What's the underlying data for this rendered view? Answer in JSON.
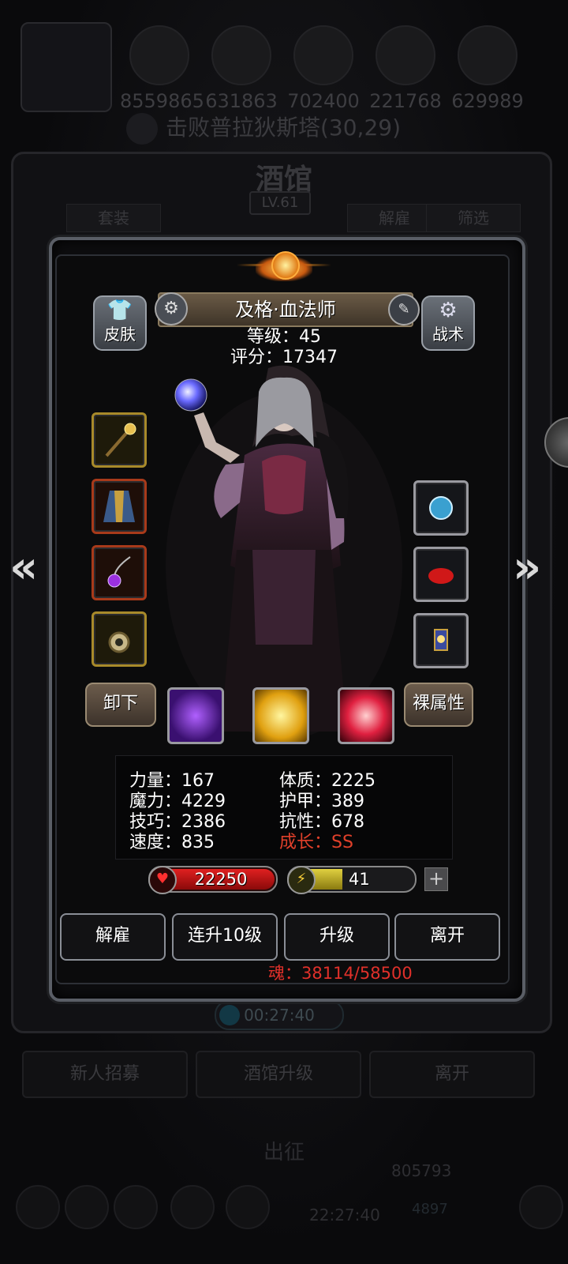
{
  "resources": [
    "8559865",
    "631863",
    "702400",
    "221768",
    "629989"
  ],
  "quest": "击败普拉狄斯塔(30,29)",
  "tavern": {
    "title": "酒馆",
    "level": "LV.61",
    "tab_left": "套装",
    "tab_dismiss": "解雇",
    "tab_filter": "筛选",
    "timer": "00:27:40",
    "btn_recruit": "新人招募",
    "btn_upgrade": "酒馆升级",
    "btn_leave": "离开",
    "sortie": "出征",
    "gold": "805793",
    "gems": "4897",
    "clock": "22:27:40"
  },
  "hero": {
    "name": "及格·血法师",
    "level_text": "等级：45",
    "score_text": "评分：17347",
    "skin_label": "皮肤",
    "tactics_label": "战术",
    "unequip_label": "卸下",
    "bare_attr_label": "裸属性",
    "left_slots": [
      "staff-icon",
      "robe-icon",
      "amulet-icon",
      "ring-icon"
    ],
    "right_slots": [
      "orb-icon",
      "gem-icon",
      "lantern-icon"
    ],
    "skills": [
      "shadow-skill-icon",
      "burst-skill-icon",
      "slash-skill-icon"
    ],
    "stats": {
      "str": "力量：167",
      "con": "体质：2225",
      "mag": "魔力：4229",
      "arm": "护甲：389",
      "skl": "技巧：2386",
      "res": "抗性：678",
      "spd": "速度：835",
      "grw": "成长：SS"
    },
    "hp": "22250",
    "energy": "41",
    "energy_fraction": 0.41,
    "actions": {
      "dismiss": "解雇",
      "level10": "连升10级",
      "levelup": "升级",
      "leave": "离开"
    },
    "soul": "魂：38114/58500"
  },
  "colors": {
    "growth": "#e0402a",
    "soul": "#e0302a",
    "hp": "#e02020",
    "energy": "#e0d040"
  }
}
